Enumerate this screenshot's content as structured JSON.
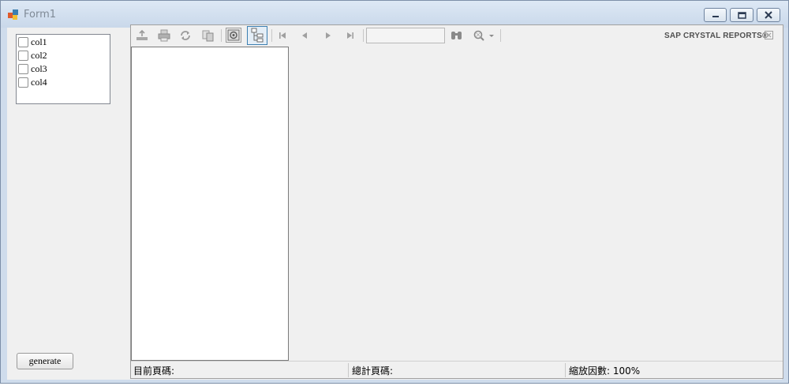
{
  "window": {
    "title": "Form1",
    "controls": {
      "minimize": "minimize-icon",
      "maximize": "maximize-icon",
      "close": "close-icon"
    }
  },
  "checklist": {
    "items": [
      {
        "label": "col1",
        "checked": false
      },
      {
        "label": "col2",
        "checked": false
      },
      {
        "label": "col3",
        "checked": false
      },
      {
        "label": "col4",
        "checked": false
      }
    ]
  },
  "generate_button": {
    "label": "generate"
  },
  "viewer": {
    "brand": "SAP CRYSTAL REPORTS®",
    "toolbar_icons": [
      "export-icon",
      "print-icon",
      "refresh-icon",
      "copy-icon",
      "toggle-parameter-panel-icon",
      "toggle-group-tree-icon",
      "first-page-icon",
      "previous-page-icon",
      "next-page-icon",
      "last-page-icon",
      "find-icon",
      "zoom-icon"
    ],
    "page_input": {
      "value": ""
    },
    "status": {
      "current_page": "目前頁碼:",
      "total_pages": "總計頁碼:",
      "zoom_factor": "縮放因數: 100%"
    }
  },
  "colors": {
    "accent": "#3c7fb1",
    "window_frame": "#cfdcec"
  }
}
